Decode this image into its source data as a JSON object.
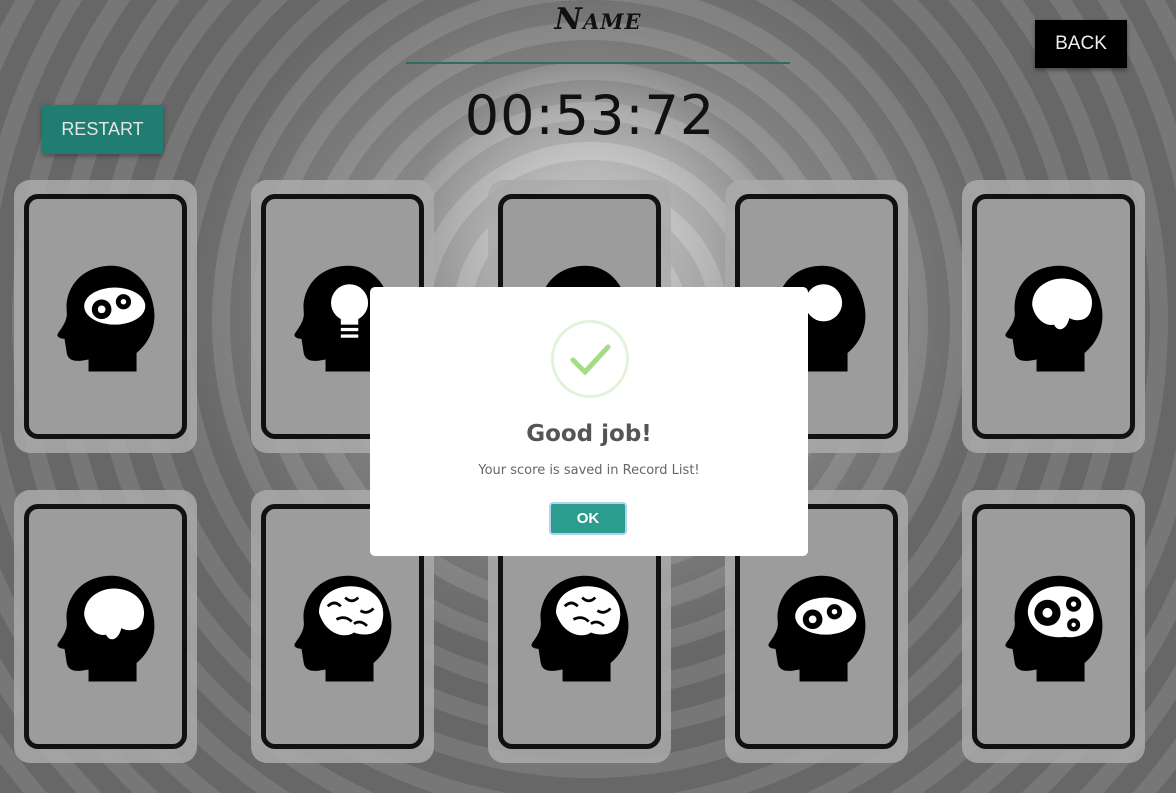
{
  "header": {
    "title": "Name",
    "timer": "00:53:72",
    "back_label": "BACK",
    "restart_label": "RESTART"
  },
  "cards": [
    {
      "icon": "head-gears-cloud-icon"
    },
    {
      "icon": "head-lightbulb-icon"
    },
    {
      "icon": "head-gears-cloud-icon"
    },
    {
      "icon": "head-lightbulb-icon"
    },
    {
      "icon": "head-brain-icon"
    },
    {
      "icon": "head-brain-icon"
    },
    {
      "icon": "head-brain-detailed-icon"
    },
    {
      "icon": "head-brain-detailed-icon"
    },
    {
      "icon": "head-gears-cloud-icon"
    },
    {
      "icon": "head-gears-icon"
    }
  ],
  "modal": {
    "title": "Good job!",
    "message": "Your score is saved in Record List!",
    "ok_label": "OK",
    "success_color": "#a5dc86"
  },
  "colors": {
    "accent": "#1f7d72",
    "ok_button": "#2a9d8f"
  }
}
